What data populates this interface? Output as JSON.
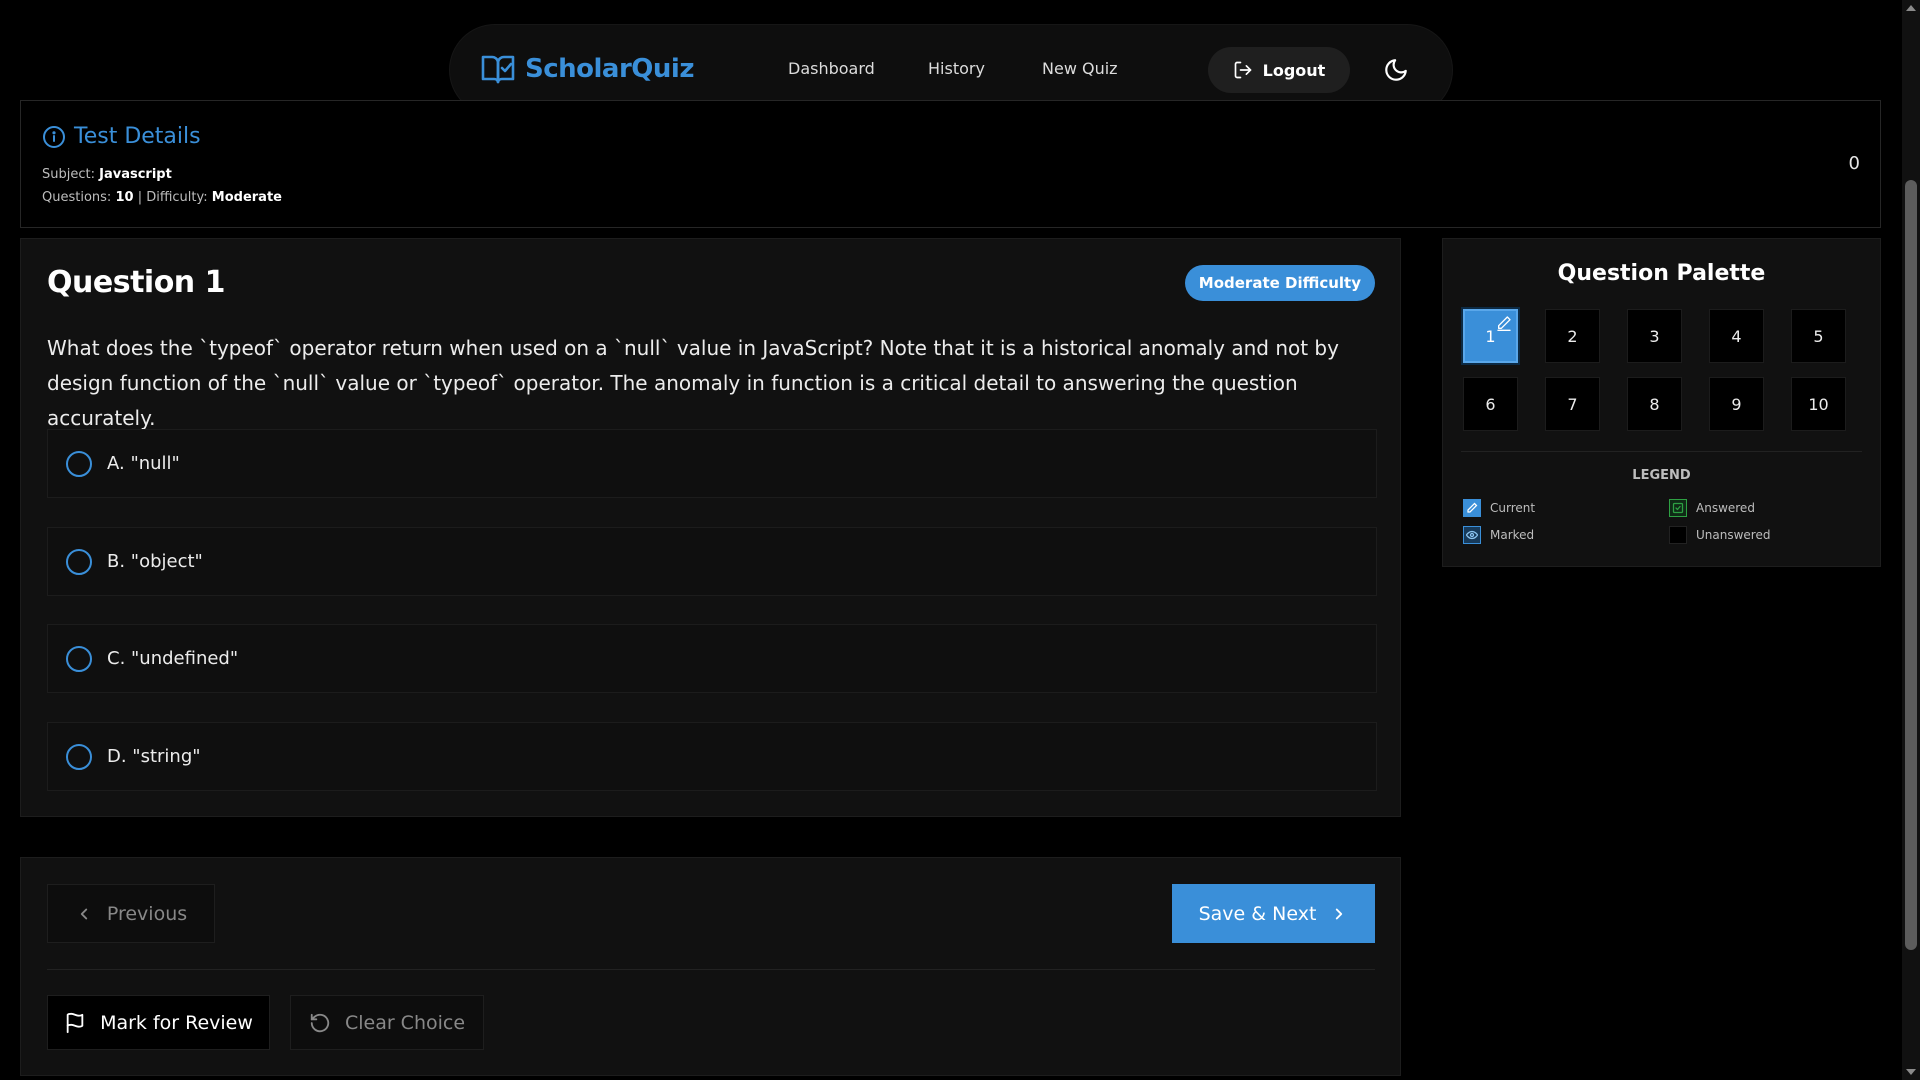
{
  "nav": {
    "brand": "ScholarQuiz",
    "links": [
      "Dashboard",
      "History",
      "New Quiz"
    ],
    "logout_label": "Logout",
    "icons": {
      "brand": "book-check-icon",
      "logout": "logout-icon",
      "theme": "moon-icon"
    }
  },
  "details": {
    "title": "Test Details",
    "subject_label": "Subject:",
    "subject_value": "Javascript",
    "questions_label": "Questions:",
    "questions_value": "10",
    "separator": "|",
    "difficulty_label": "Difficulty:",
    "difficulty_value": "Moderate",
    "timer": "0"
  },
  "question": {
    "title": "Question 1",
    "badge": "Moderate Difficulty",
    "text": "What does the `typeof` operator return when used on a `null` value in JavaScript? Note that it is a historical anomaly and not by design function of the `null` value or `typeof` operator. The anomaly in function is a critical detail to answering the question accurately.",
    "options": [
      "A. \"null\"",
      "B. \"object\"",
      "C. \"undefined\"",
      "D. \"string\""
    ]
  },
  "palette": {
    "title": "Question Palette",
    "numbers": [
      "1",
      "2",
      "3",
      "4",
      "5",
      "6",
      "7",
      "8",
      "9",
      "10"
    ],
    "current": "1",
    "legend_title": "LEGEND",
    "legend": {
      "current": "Current",
      "answered": "Answered",
      "marked": "Marked",
      "unanswered": "Unanswered"
    }
  },
  "controls": {
    "previous": "Previous",
    "save_next": "Save & Next",
    "mark_review": "Mark for Review",
    "clear_choice": "Clear Choice"
  },
  "colors": {
    "accent": "#3a8fd9",
    "answered": "#2ea043",
    "background": "#000000",
    "card": "#111111"
  }
}
